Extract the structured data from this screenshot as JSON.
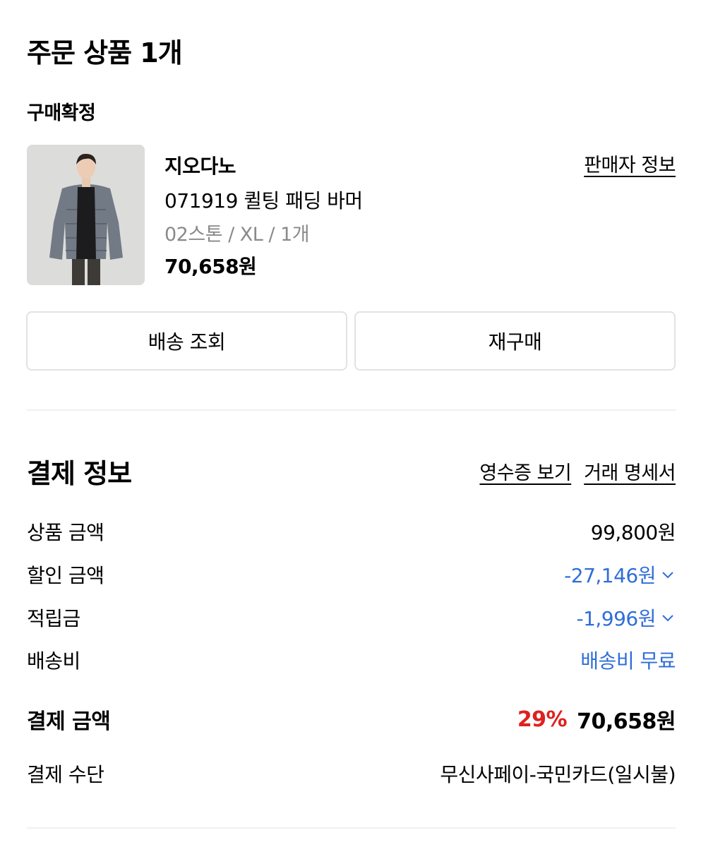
{
  "order": {
    "title": "주문 상품 1개",
    "status": "구매확정"
  },
  "product": {
    "brand": "지오다노",
    "seller_link": "판매자 정보",
    "name": "071919 퀼팅 패딩 바머",
    "option": "02스톤 / XL / 1개",
    "price": "70,658원"
  },
  "buttons": {
    "track": "배송 조회",
    "rebuy": "재구매"
  },
  "payment": {
    "title": "결제 정보",
    "receipt_link": "영수증 보기",
    "statement_link": "거래 명세서",
    "rows": [
      {
        "label": "상품 금액",
        "value": "99,800원"
      },
      {
        "label": "할인 금액",
        "value": "-27,146원"
      },
      {
        "label": "적립금",
        "value": "-1,996원"
      },
      {
        "label": "배송비",
        "value": "배송비 무료"
      }
    ],
    "total_label": "결제 금액",
    "discount_rate": "29%",
    "total_value": "70,658원",
    "method_label": "결제 수단",
    "method_value": "무신사페이-국민카드(일시불)"
  },
  "colors": {
    "accent_blue": "#2f6ed8",
    "discount_red": "#e02020",
    "divider": "#f0f0f0"
  }
}
